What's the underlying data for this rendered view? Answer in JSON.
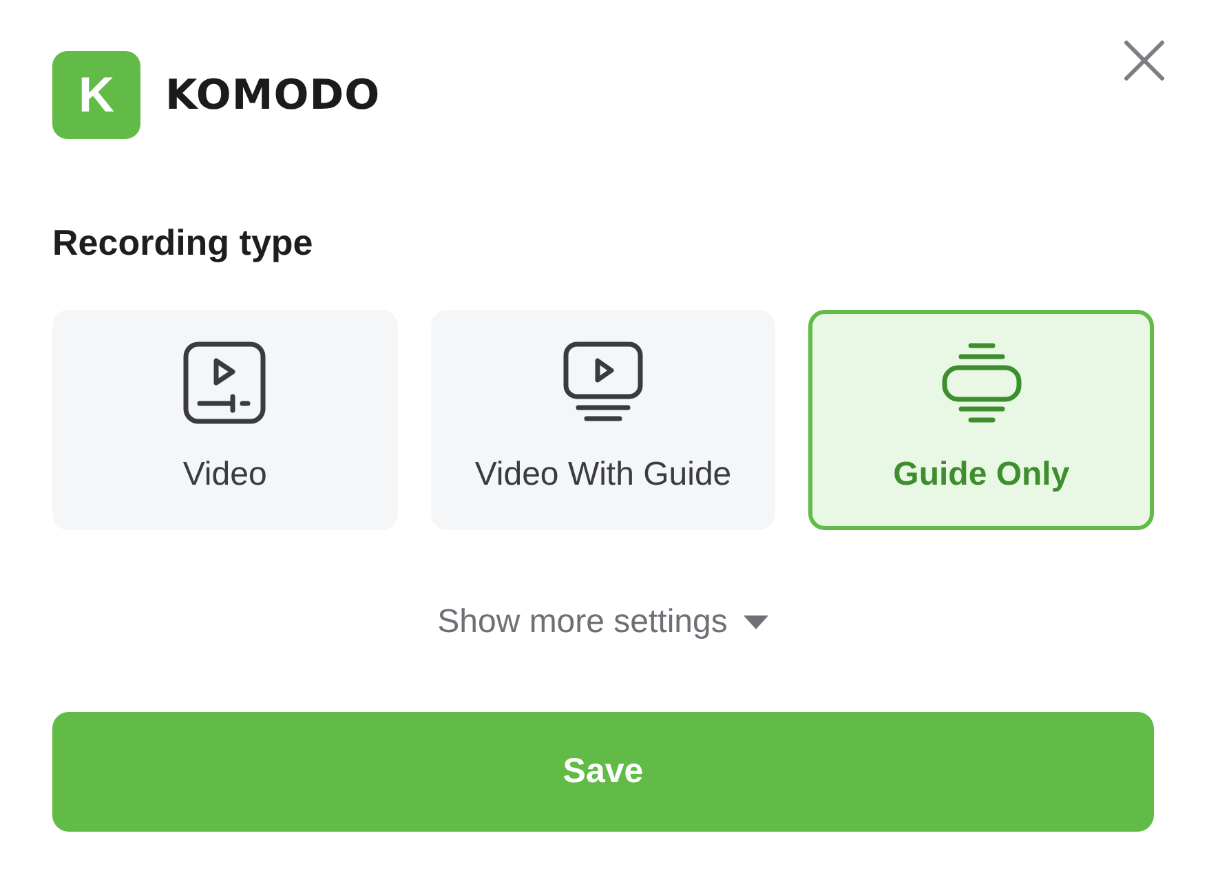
{
  "logo": {
    "letter": "K",
    "name": "KOMODO"
  },
  "heading": "Recording type",
  "options": [
    {
      "kind": "video",
      "label": "Video",
      "selected": false
    },
    {
      "kind": "video_guide",
      "label": "Video With Guide",
      "selected": false
    },
    {
      "kind": "guide",
      "label": "Guide Only",
      "selected": true
    }
  ],
  "more_settings": {
    "label": "Show more settings",
    "expanded": false
  },
  "save_button": {
    "label": "Save"
  }
}
